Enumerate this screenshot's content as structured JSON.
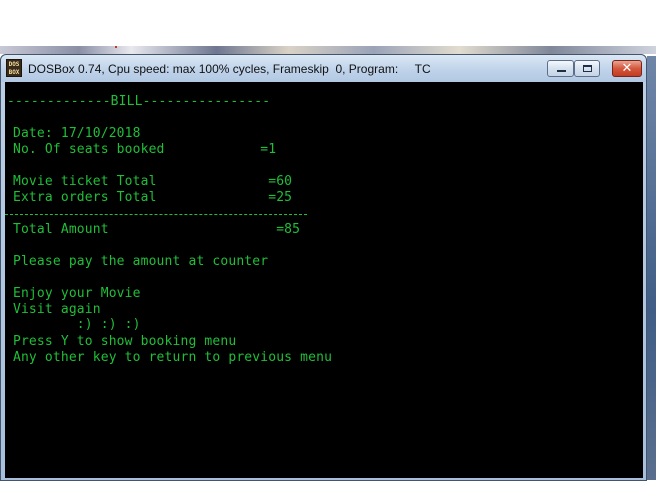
{
  "window": {
    "title": "DOSBox 0.74, Cpu speed: max 100% cycles, Frameskip  0, Program:     TC",
    "icon_label": "DOS BOX",
    "icon_name": "dosbox-icon",
    "controls": {
      "minimize": "minimize-icon",
      "maximize": "maximize-icon",
      "close": "✕"
    }
  },
  "colors": {
    "console_text": "#1fbf38",
    "console_background": "#000000"
  },
  "bill": {
    "heading": "--------------BILL----------------",
    "date_line": " Date: 17/10/2018",
    "seats_line": " No. Of seats booked            =1",
    "movie_total_line": " Movie ticket Total              =60",
    "extra_orders_line": " Extra orders Total              =25",
    "total_line": " Total Amount                     =85",
    "pay_line": " Please pay the amount at counter",
    "enjoy_line": " Enjoy your Movie",
    "visit_line": " Visit again",
    "smiley_line": "         :) :) :)",
    "press_y_line": " Press Y to show booking menu",
    "other_key_line": " Any other key to return to previous menu"
  }
}
